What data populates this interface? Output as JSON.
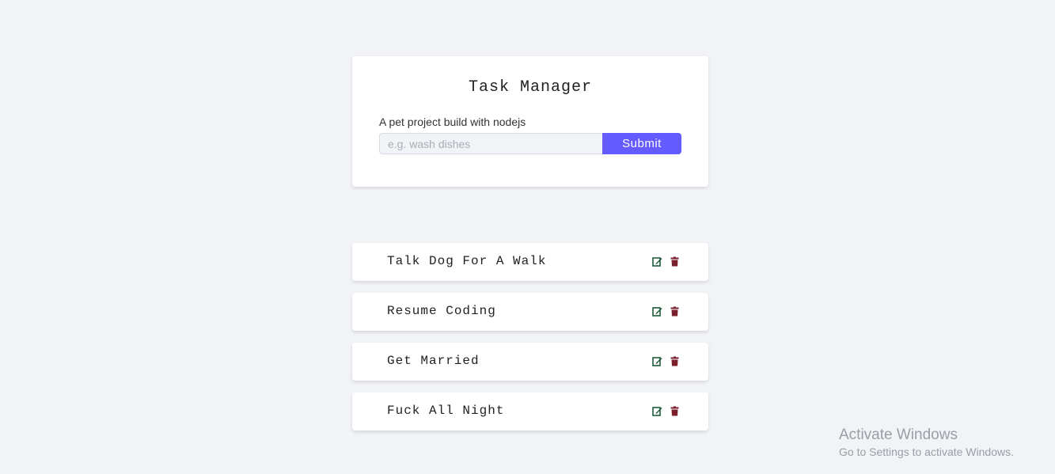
{
  "form": {
    "title": "Task Manager",
    "subtitle": "A pet project build with nodejs",
    "input_placeholder": "e.g. wash dishes",
    "input_value": "",
    "submit_label": "Submit"
  },
  "tasks": [
    {
      "name": "Talk Dog For A Walk"
    },
    {
      "name": "Resume Coding"
    },
    {
      "name": "Get Married"
    },
    {
      "name": "Fuck All Night"
    }
  ],
  "icons": {
    "edit": "edit-icon",
    "delete": "trash-icon"
  },
  "colors": {
    "background": "#f1f3f7",
    "accent": "#645cff",
    "edit_icon": "#1d5c3a",
    "delete_icon": "#7a1f2b"
  },
  "watermark": {
    "title": "Activate Windows",
    "subtitle": "Go to Settings to activate Windows."
  }
}
